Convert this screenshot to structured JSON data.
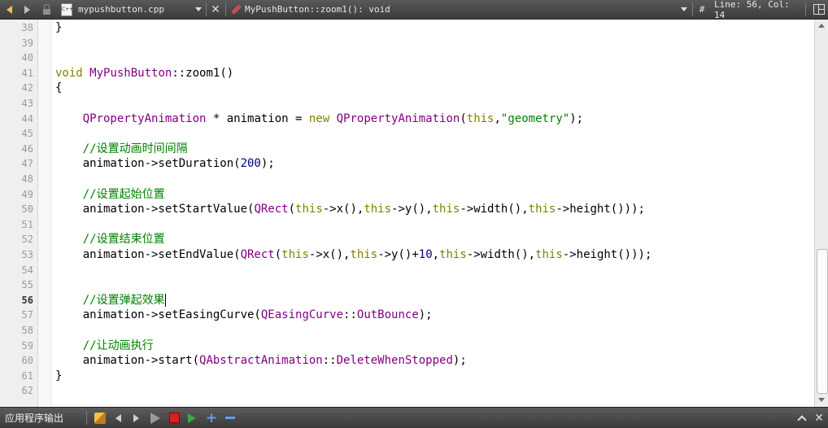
{
  "toolbar": {
    "file_tab": "mypushbutton.cpp",
    "symbol": "MyPushButton::zoom1(): void",
    "hash": "#",
    "position": "Line: 56, Col: 14",
    "file_icon_text": "C++"
  },
  "editor": {
    "current_line": 56,
    "lines": [
      {
        "num": "38",
        "text": "}"
      },
      {
        "num": "39",
        "text": ""
      },
      {
        "num": "40",
        "text": ""
      },
      {
        "num": "41",
        "text": "void MyPushButton::zoom1()"
      },
      {
        "num": "42",
        "text": "{"
      },
      {
        "num": "43",
        "text": ""
      },
      {
        "num": "44",
        "text": "    QPropertyAnimation * animation = new QPropertyAnimation(this,\"geometry\");"
      },
      {
        "num": "45",
        "text": ""
      },
      {
        "num": "46",
        "text": "    //设置动画时间间隔"
      },
      {
        "num": "47",
        "text": "    animation->setDuration(200);"
      },
      {
        "num": "48",
        "text": ""
      },
      {
        "num": "49",
        "text": "    //设置起始位置"
      },
      {
        "num": "50",
        "text": "    animation->setStartValue(QRect(this->x(),this->y(),this->width(),this->height()));"
      },
      {
        "num": "51",
        "text": ""
      },
      {
        "num": "52",
        "text": "    //设置结束位置"
      },
      {
        "num": "53",
        "text": "    animation->setEndValue(QRect(this->x(),this->y()+10,this->width(),this->height()));"
      },
      {
        "num": "54",
        "text": ""
      },
      {
        "num": "55",
        "text": ""
      },
      {
        "num": "56",
        "text": "    //设置弹起效果"
      },
      {
        "num": "57",
        "text": "    animation->setEasingCurve(QEasingCurve::OutBounce);"
      },
      {
        "num": "58",
        "text": ""
      },
      {
        "num": "59",
        "text": "    //让动画执行"
      },
      {
        "num": "60",
        "text": "    animation->start(QAbstractAnimation::DeleteWhenStopped);"
      },
      {
        "num": "61",
        "text": "}"
      },
      {
        "num": "62",
        "text": ""
      }
    ]
  },
  "bottom": {
    "pane_title": "应用程序输出"
  },
  "colors": {
    "keyword": "#808000",
    "type": "#800080",
    "comment": "#008000",
    "number": "#000080"
  }
}
